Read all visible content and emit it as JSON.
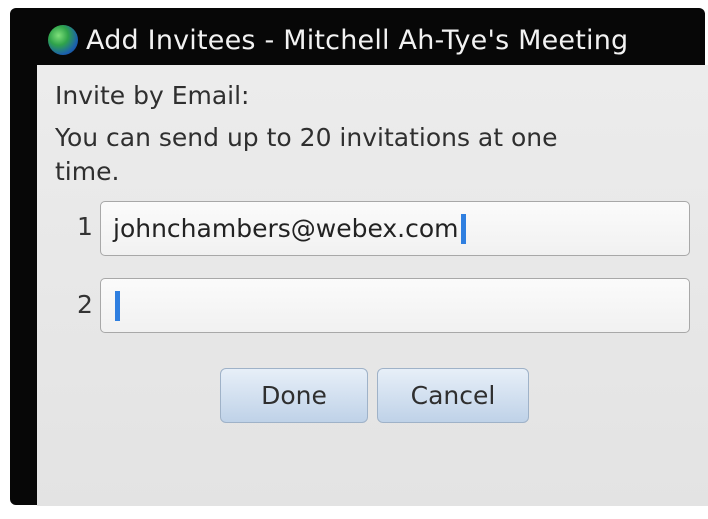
{
  "window": {
    "title": "Add Invitees - Mitchell Ah-Tye's Meeting",
    "icon": "globe-icon"
  },
  "dialog": {
    "heading": "Invite by Email:",
    "description_line1": "You can send up to 20 invitations at one",
    "description_line2": "time."
  },
  "invitees": [
    {
      "number": "1",
      "value": "johnchambers@webex.com"
    },
    {
      "number": "2",
      "value": ""
    }
  ],
  "buttons": {
    "done_label": "Done",
    "cancel_label": "Cancel"
  },
  "colors": {
    "cursor": "#2f7fe0",
    "button_gradient_top": "#e7eff8",
    "button_gradient_bottom": "#bfd2e8"
  }
}
